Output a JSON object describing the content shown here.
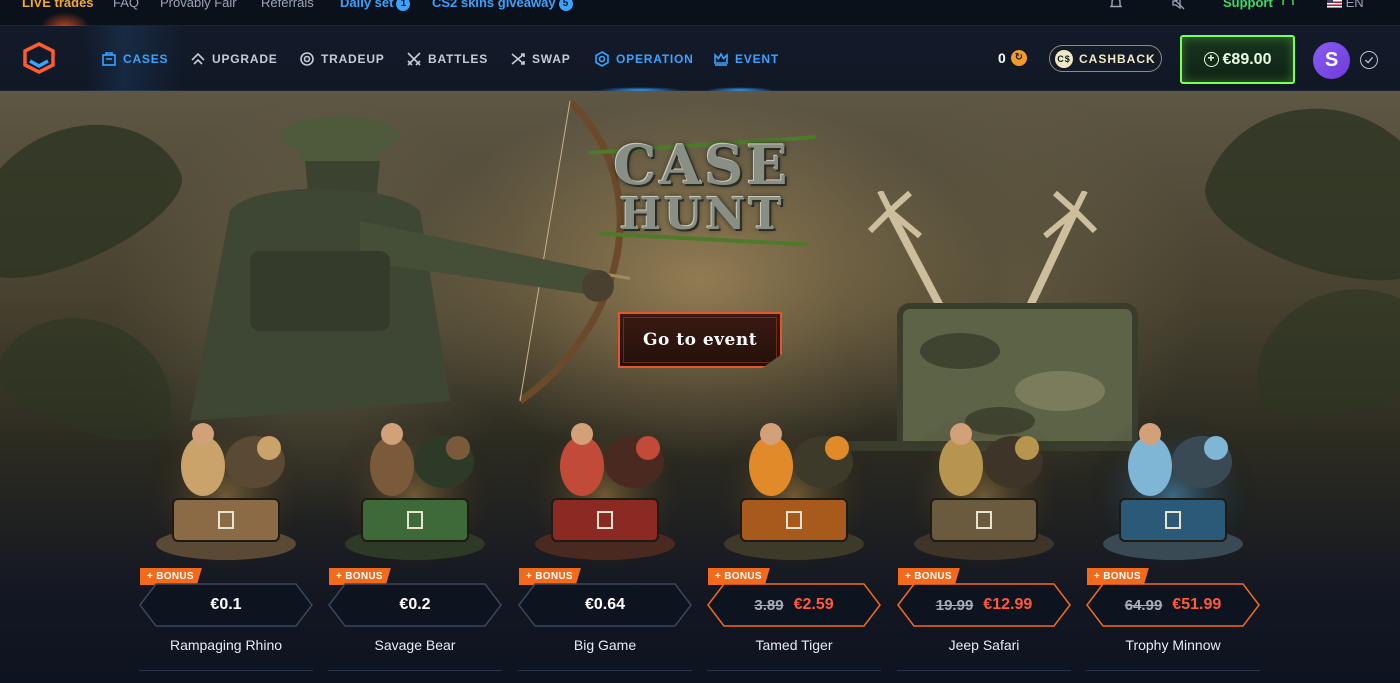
{
  "topbar": {
    "live_trades": "LIVE trades",
    "faq": "FAQ",
    "provably_fair": "Provably Fair",
    "referrals": "Referrals",
    "daily_set": "Daily set",
    "daily_set_badge": "1",
    "giveaway": "CS2 skins giveaway",
    "giveaway_badge": "5",
    "support": "Support",
    "language": "EN"
  },
  "nav": {
    "items": [
      {
        "label": "CASES",
        "icon": "case-icon"
      },
      {
        "label": "UPGRADE",
        "icon": "upgrade-icon"
      },
      {
        "label": "TRADEUP",
        "icon": "tradeup-icon"
      },
      {
        "label": "BATTLES",
        "icon": "battles-icon"
      },
      {
        "label": "SWAP",
        "icon": "swap-icon"
      },
      {
        "label": "OPERATION",
        "icon": "operation-icon"
      },
      {
        "label": "EVENT",
        "icon": "crown-icon"
      }
    ],
    "coins": "0",
    "cashback_label": "CASHBACK",
    "balance": "€89.00",
    "avatar_letter": "S"
  },
  "hero": {
    "event_title_line1": "CASE",
    "event_title_line2": "HUNT",
    "cta_label": "Go to event"
  },
  "cases": [
    {
      "name": "Rampaging Rhino",
      "price": "€0.1",
      "bonus": "+ BONUS"
    },
    {
      "name": "Savage Bear",
      "price": "€0.2",
      "bonus": "+ BONUS"
    },
    {
      "name": "Big Game",
      "price": "€0.64",
      "bonus": "+ BONUS"
    },
    {
      "name": "Tamed Tiger",
      "old_price": "3.89",
      "price": "€2.59",
      "bonus": "+ BONUS"
    },
    {
      "name": "Jeep Safari",
      "old_price": "19.99",
      "price": "€12.99",
      "bonus": "+ BONUS"
    },
    {
      "name": "Trophy Minnow",
      "old_price": "64.99",
      "price": "€51.99",
      "bonus": "+ BONUS"
    }
  ],
  "colors": {
    "accent_blue": "#3ba3ff",
    "bonus_orange": "#f26b1d",
    "sale_red": "#ff5a3c",
    "balance_green": "#7dff5a",
    "background": "#0d1320"
  }
}
